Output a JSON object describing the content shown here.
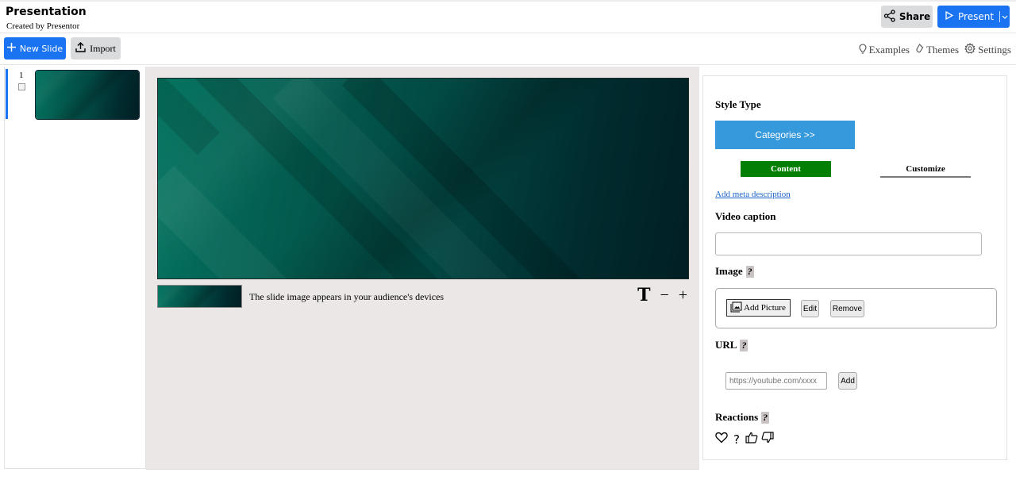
{
  "header": {
    "title": "Presentation",
    "subtitle": "Created by Presentor",
    "share_label": "Share",
    "present_label": "Present"
  },
  "toolbar": {
    "new_slide_label": "New Slide",
    "import_label": "Import",
    "links": [
      {
        "label": "Examples",
        "icon": "lightbulb-icon"
      },
      {
        "label": "Themes",
        "icon": "palette-icon"
      },
      {
        "label": "Settings",
        "icon": "gear-icon"
      }
    ]
  },
  "sidebar": {
    "slides": [
      {
        "number": "1",
        "selected": true
      }
    ]
  },
  "canvas": {
    "caption_text": "The slide image appears in your audience's devices",
    "text_tool": "T",
    "minus": "−",
    "plus": "+"
  },
  "panel": {
    "style_type_label": "Style Type",
    "categories_label": "Categories >>",
    "tabs": [
      {
        "label": "Content",
        "active": true
      },
      {
        "label": "Customize",
        "active": false
      }
    ],
    "meta_link": "Add meta description",
    "video_caption_label": "Video caption",
    "video_caption_value": "",
    "image_label": "Image",
    "help_glyph": "?",
    "add_picture_label": "Add Picture",
    "edit_label": "Edit",
    "remove_label": "Remove",
    "url_label": "URL",
    "url_placeholder": "https://youtube.com/xxxx",
    "url_add_label": "Add",
    "reactions_label": "Reactions",
    "reactions": [
      "heart",
      "question",
      "thumbs-up",
      "thumbs-down"
    ]
  },
  "colors": {
    "primary": "#1a73f0",
    "categories": "#3699dc",
    "active_tab": "#038003",
    "canvas_bg": "#ebe7e6",
    "slide_teal": "#03594d"
  }
}
